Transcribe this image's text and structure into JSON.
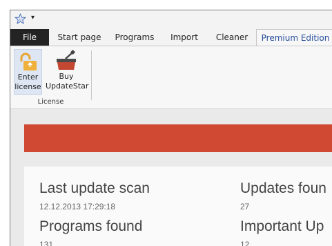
{
  "quick_access": {
    "star_icon": "star-icon",
    "dropdown_glyph": "▾"
  },
  "tabs": [
    {
      "label": "File"
    },
    {
      "label": "Start page"
    },
    {
      "label": "Programs"
    },
    {
      "label": "Import"
    },
    {
      "label": "Cleaner"
    },
    {
      "label": "Premium Edition"
    }
  ],
  "ribbon": {
    "group_label": "License",
    "buttons": [
      {
        "label": "Enter\nlicense",
        "icon": "unlock-icon"
      },
      {
        "label": "Buy\nUpdateStar",
        "icon": "basket-icon"
      }
    ]
  },
  "banner": {
    "color": "#d04a33"
  },
  "stats": {
    "last_update_scan": {
      "label": "Last update scan",
      "value": "12.12.2013 17:29:18"
    },
    "updates_found": {
      "label": "Updates foun",
      "value": "27"
    },
    "programs_found": {
      "label": "Programs found",
      "value": "131"
    },
    "important_updates": {
      "label": "Important Up",
      "value": "12"
    }
  }
}
